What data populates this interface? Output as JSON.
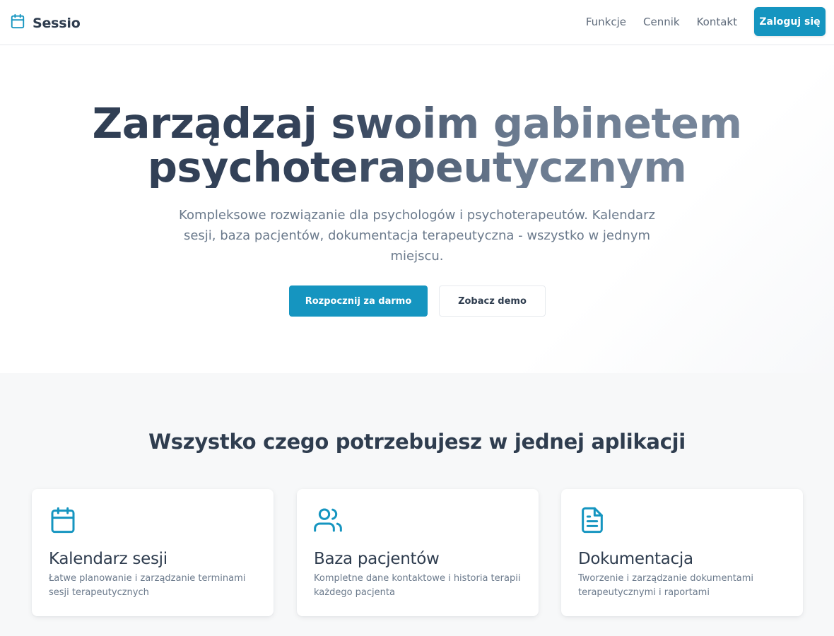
{
  "header": {
    "brand": "Sessio",
    "nav": [
      "Funkcje",
      "Cennik",
      "Kontakt"
    ],
    "login_label": "Zaloguj się"
  },
  "hero": {
    "title": "Zarządzaj swoim gabinetem psychoterapeutycznym",
    "subtitle": "Kompleksowe rozwiązanie dla psychologów i psychoterapeutów. Kalendarz sesji, baza pacjentów, dokumentacja terapeutyczna - wszystko w jednym miejscu.",
    "primary_cta": "Rozpocznij za darmo",
    "secondary_cta": "Zobacz demo"
  },
  "features": {
    "title": "Wszystko czego potrzebujesz w jednej aplikacji",
    "cards": [
      {
        "icon": "calendar-icon",
        "title": "Kalendarz sesji",
        "description": "Łatwe planowanie i zarządzanie terminami sesji terapeutycznych"
      },
      {
        "icon": "users-icon",
        "title": "Baza pacjentów",
        "description": "Kompletne dane kontaktowe i historia terapii każdego pacjenta"
      },
      {
        "icon": "document-icon",
        "title": "Dokumentacja",
        "description": "Tworzenie i zarządzanie dokumentami terapeutycznymi i raportami"
      }
    ]
  },
  "colors": {
    "accent": "#1595c0",
    "heading": "#2f3d4f",
    "muted": "#6b7a8c",
    "section_bg": "#f7f8f9"
  }
}
